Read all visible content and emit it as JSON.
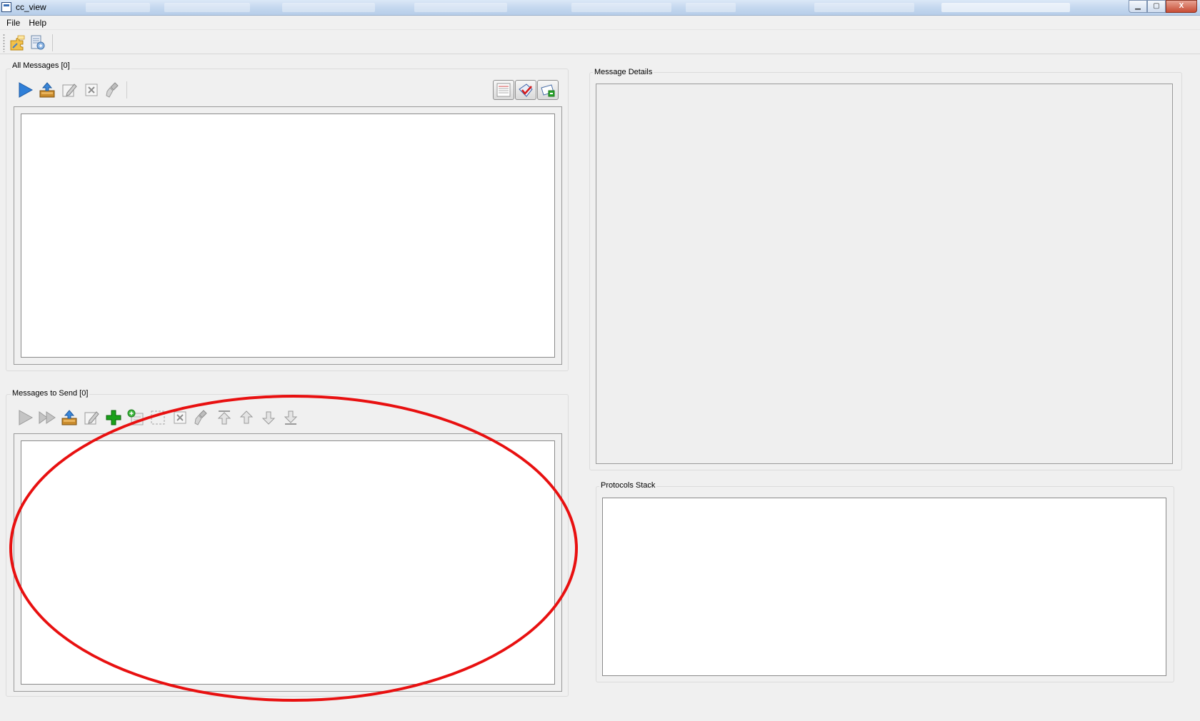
{
  "window": {
    "title": "cc_view"
  },
  "menu": {
    "items": [
      "File",
      "Help"
    ]
  },
  "all_messages": {
    "label": "All Messages [0]"
  },
  "messages_to_send": {
    "label": "Messages to Send [0]"
  },
  "message_details": {
    "label": "Message Details"
  },
  "protocols_stack": {
    "label": "Protocols Stack"
  },
  "window_controls": {
    "minimize": "▁",
    "maximize": "▢",
    "close": "X"
  },
  "colors": {
    "annotation": "#e81010",
    "accent_blue": "#2f7fd8",
    "add_green": "#1aa01a"
  },
  "icons": {
    "toolbar": [
      "plugin-config-icon",
      "plugin-list-icon"
    ],
    "all_messages_toolbar": [
      "play-icon",
      "load-icon",
      "edit-icon",
      "delete-icon",
      "clear-icon"
    ],
    "all_messages_view": [
      "view-list-icon",
      "view-check-icon",
      "view-send-icon"
    ],
    "messages_to_send_toolbar": [
      "play-icon",
      "fast-forward-icon",
      "load-icon",
      "edit-icon",
      "add-icon",
      "add-raw-icon",
      "select-icon",
      "delete-icon",
      "clear-icon",
      "move-top-icon",
      "move-up-icon",
      "move-down-icon",
      "move-bottom-icon"
    ]
  }
}
